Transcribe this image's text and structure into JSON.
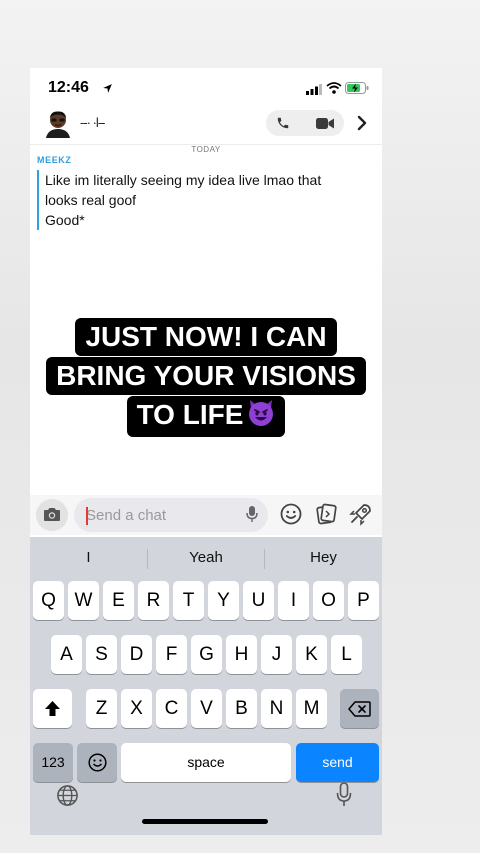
{
  "status_bar": {
    "time": "12:46"
  },
  "chat": {
    "contact_name": "--·  ·l--",
    "date_label": "TODAY",
    "sender": "MEEKZ",
    "messages": [
      "Like im literally seeing my idea live lmao that",
      "looks real goof",
      "Good*"
    ]
  },
  "overlay_caption": {
    "lines": [
      "JUST NOW! I CAN",
      "BRING YOUR VISIONS",
      "TO LIFE"
    ]
  },
  "input_bar": {
    "placeholder": "Send a chat"
  },
  "keyboard": {
    "suggestions": [
      "I",
      "Yeah",
      "Hey"
    ],
    "row1": [
      "Q",
      "W",
      "E",
      "R",
      "T",
      "Y",
      "U",
      "I",
      "O",
      "P"
    ],
    "row2": [
      "A",
      "S",
      "D",
      "F",
      "G",
      "H",
      "J",
      "K",
      "L"
    ],
    "row3": [
      "Z",
      "X",
      "C",
      "V",
      "B",
      "N",
      "M"
    ],
    "numbers_key": "123",
    "space_key": "space",
    "send_key": "send"
  },
  "colors": {
    "accent": "#2f9fe0",
    "send_key": "#0a84ff",
    "caption_bg": "#000000"
  }
}
